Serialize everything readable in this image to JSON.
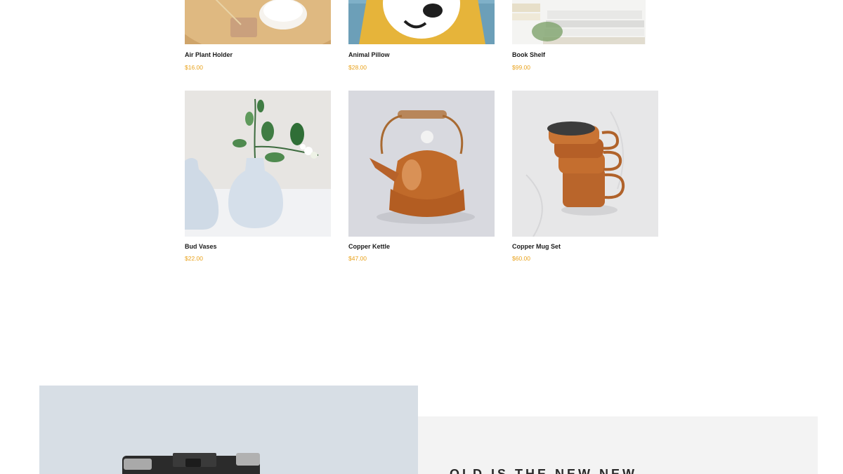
{
  "products": [
    {
      "name": "Air Plant Holder",
      "price": "$16.00",
      "image": "air-plant-holder-image"
    },
    {
      "name": "Animal Pillow",
      "price": "$28.00",
      "image": "animal-pillow-image"
    },
    {
      "name": "Book Shelf",
      "price": "$99.00",
      "image": "book-shelf-image"
    },
    {
      "name": "Bud Vases",
      "price": "$22.00",
      "image": "bud-vases-image"
    },
    {
      "name": "Copper Kettle",
      "price": "$47.00",
      "image": "copper-kettle-image"
    },
    {
      "name": "Copper Mug Set",
      "price": "$60.00",
      "image": "copper-mug-set-image"
    }
  ],
  "feature": {
    "heading": "OLD IS THE NEW NEW",
    "image": "vintage-camera-image"
  },
  "colors": {
    "price": "#e9a21c",
    "feature_panel": "#f3f3f3",
    "feature_image_bg": "#d7dee5"
  }
}
